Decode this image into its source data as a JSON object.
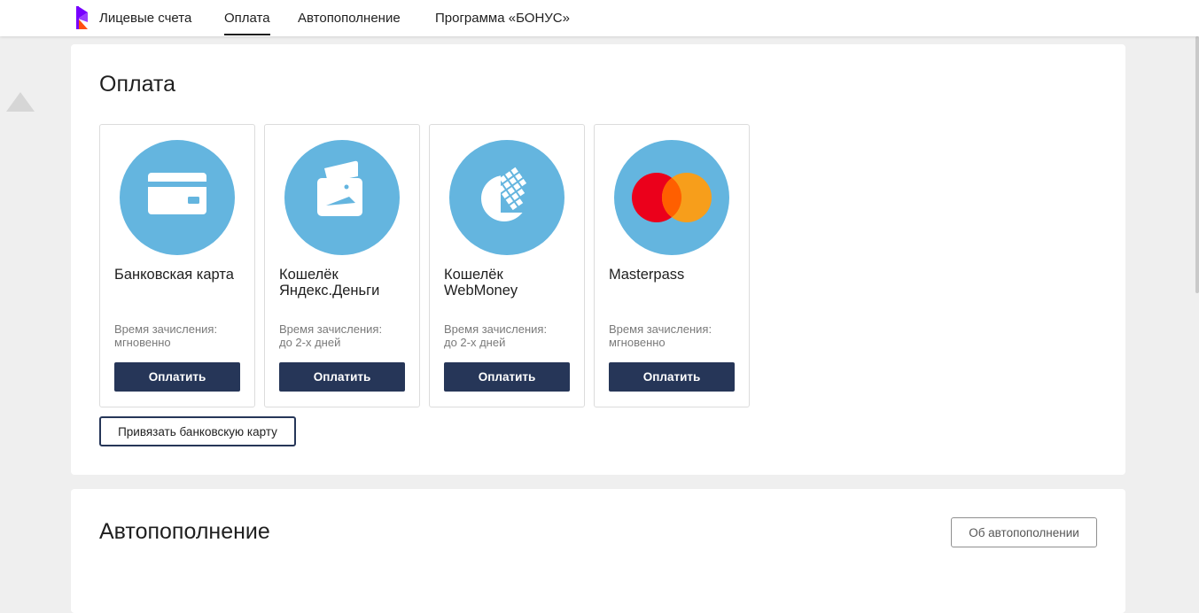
{
  "nav": {
    "items": [
      {
        "label": "Лицевые счета"
      },
      {
        "label": "Оплата"
      },
      {
        "label": "Автопополнение"
      },
      {
        "label": "Программа «БОНУС»"
      }
    ],
    "active": "Оплата"
  },
  "icons": {
    "logo": "rostelecom-logo",
    "scroll": "scroll-up-arrow-icon",
    "card_icons": [
      "bank-card-icon",
      "yandex-wallet-icon",
      "webmoney-icon",
      "masterpass-icon"
    ]
  },
  "colors": {
    "accent_button": "#263658",
    "icon_circle": "#64b5df",
    "logo_purple": "#7700ff",
    "logo_orange": "#ff4f12",
    "mastercard_red": "#eb001b",
    "mastercard_orange": "#f79e1b"
  },
  "payment": {
    "title": "Оплата",
    "cards": [
      {
        "title": "Банковская карта",
        "time_label": "Время зачисления:",
        "time_value": "мгновенно",
        "button": "Оплатить"
      },
      {
        "title": "Кошелёк Яндекс.Деньги",
        "time_label": "Время зачисления:",
        "time_value": "до 2-х дней",
        "button": "Оплатить"
      },
      {
        "title": "Кошелёк WebMoney",
        "time_label": "Время зачисления:",
        "time_value": "до 2-х дней",
        "button": "Оплатить"
      },
      {
        "title": "Masterpass",
        "time_label": "Время зачисления:",
        "time_value": "мгновенно",
        "button": "Оплатить"
      }
    ],
    "bind_card_button": "Привязать банковскую карту"
  },
  "autopay": {
    "title": "Автопополнение",
    "about_button": "Об автопополнении"
  }
}
